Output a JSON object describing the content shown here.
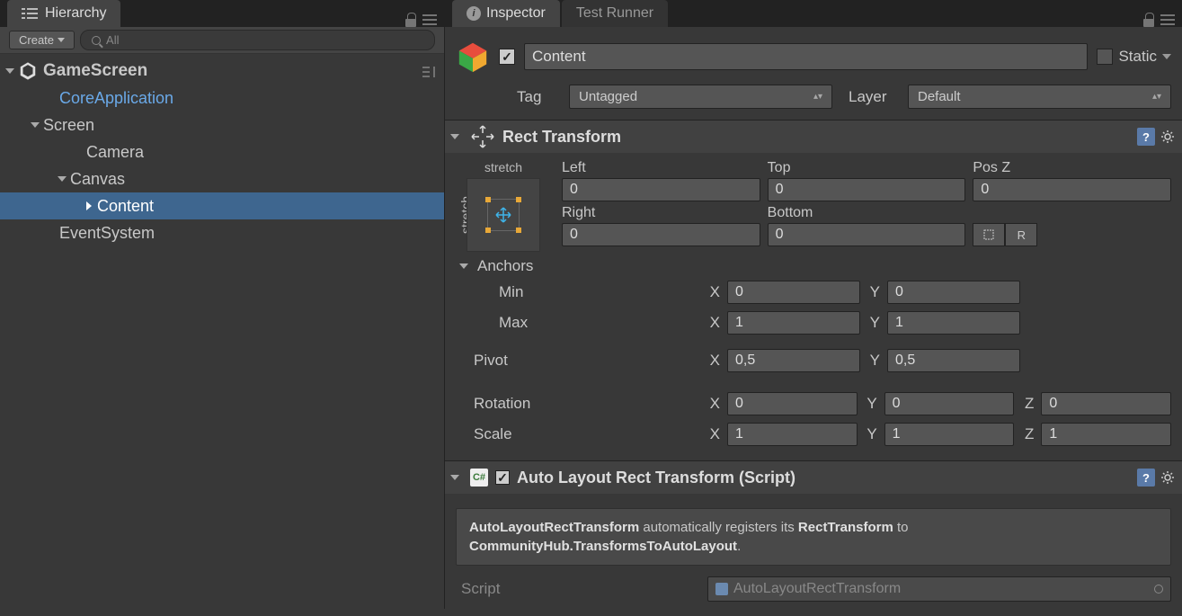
{
  "hierarchy": {
    "tab_label": "Hierarchy",
    "create_label": "Create",
    "search_placeholder": "All",
    "root": "GameScreen",
    "items": {
      "core_app": "CoreApplication",
      "screen": "Screen",
      "camera": "Camera",
      "canvas": "Canvas",
      "content": "Content",
      "event_system": "EventSystem"
    }
  },
  "inspector": {
    "tab_label": "Inspector",
    "test_runner_tab": "Test Runner",
    "name": "Content",
    "static_label": "Static",
    "tag_label": "Tag",
    "tag_value": "Untagged",
    "layer_label": "Layer",
    "layer_value": "Default"
  },
  "rect_transform": {
    "title": "Rect Transform",
    "stretch": "stretch",
    "labels": {
      "left": "Left",
      "top": "Top",
      "posz": "Pos Z",
      "right": "Right",
      "bottom": "Bottom"
    },
    "values": {
      "left": "0",
      "top": "0",
      "posz": "0",
      "right": "0",
      "bottom": "0"
    },
    "anchors_label": "Anchors",
    "min_label": "Min",
    "max_label": "Max",
    "min": {
      "x": "0",
      "y": "0"
    },
    "max": {
      "x": "1",
      "y": "1"
    },
    "pivot_label": "Pivot",
    "pivot": {
      "x": "0,5",
      "y": "0,5"
    },
    "rotation_label": "Rotation",
    "rotation": {
      "x": "0",
      "y": "0",
      "z": "0"
    },
    "scale_label": "Scale",
    "scale": {
      "x": "1",
      "y": "1",
      "z": "1"
    },
    "mini_r": "R"
  },
  "auto_layout": {
    "title": "Auto Layout Rect Transform (Script)",
    "info_strong1": "AutoLayoutRectTransform",
    "info_mid": " automatically registers its ",
    "info_strong2": "RectTransform",
    "info_end": " to ",
    "info_strong3": "CommunityHub.TransformsToAutoLayout",
    "script_label": "Script",
    "script_value": "AutoLayoutRectTransform"
  }
}
